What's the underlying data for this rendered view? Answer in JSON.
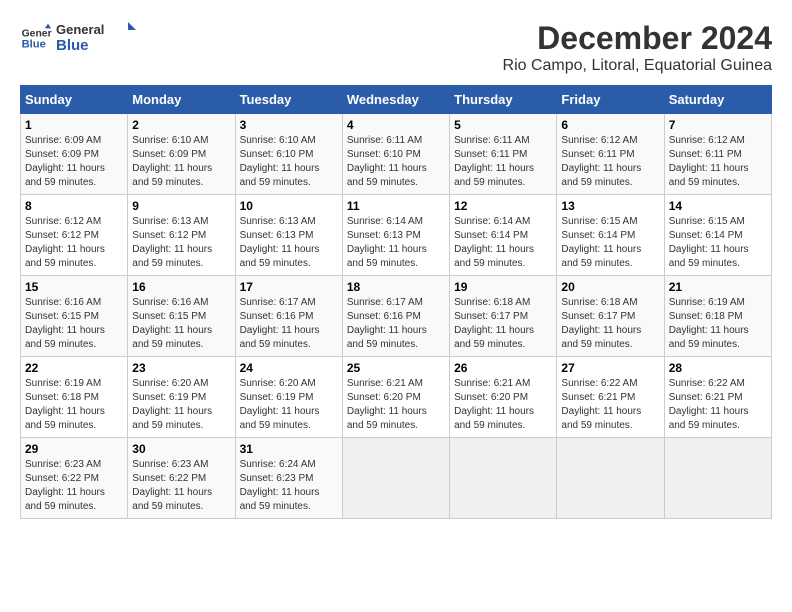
{
  "header": {
    "logo_general": "General",
    "logo_blue": "Blue",
    "title": "December 2024",
    "subtitle": "Rio Campo, Litoral, Equatorial Guinea"
  },
  "calendar": {
    "weekdays": [
      "Sunday",
      "Monday",
      "Tuesday",
      "Wednesday",
      "Thursday",
      "Friday",
      "Saturday"
    ],
    "weeks": [
      [
        {
          "day": "1",
          "sunrise": "6:09 AM",
          "sunset": "6:09 PM",
          "daylight": "11 hours and 59 minutes."
        },
        {
          "day": "2",
          "sunrise": "6:10 AM",
          "sunset": "6:09 PM",
          "daylight": "11 hours and 59 minutes."
        },
        {
          "day": "3",
          "sunrise": "6:10 AM",
          "sunset": "6:10 PM",
          "daylight": "11 hours and 59 minutes."
        },
        {
          "day": "4",
          "sunrise": "6:11 AM",
          "sunset": "6:10 PM",
          "daylight": "11 hours and 59 minutes."
        },
        {
          "day": "5",
          "sunrise": "6:11 AM",
          "sunset": "6:11 PM",
          "daylight": "11 hours and 59 minutes."
        },
        {
          "day": "6",
          "sunrise": "6:12 AM",
          "sunset": "6:11 PM",
          "daylight": "11 hours and 59 minutes."
        },
        {
          "day": "7",
          "sunrise": "6:12 AM",
          "sunset": "6:11 PM",
          "daylight": "11 hours and 59 minutes."
        }
      ],
      [
        {
          "day": "8",
          "sunrise": "6:12 AM",
          "sunset": "6:12 PM",
          "daylight": "11 hours and 59 minutes."
        },
        {
          "day": "9",
          "sunrise": "6:13 AM",
          "sunset": "6:12 PM",
          "daylight": "11 hours and 59 minutes."
        },
        {
          "day": "10",
          "sunrise": "6:13 AM",
          "sunset": "6:13 PM",
          "daylight": "11 hours and 59 minutes."
        },
        {
          "day": "11",
          "sunrise": "6:14 AM",
          "sunset": "6:13 PM",
          "daylight": "11 hours and 59 minutes."
        },
        {
          "day": "12",
          "sunrise": "6:14 AM",
          "sunset": "6:14 PM",
          "daylight": "11 hours and 59 minutes."
        },
        {
          "day": "13",
          "sunrise": "6:15 AM",
          "sunset": "6:14 PM",
          "daylight": "11 hours and 59 minutes."
        },
        {
          "day": "14",
          "sunrise": "6:15 AM",
          "sunset": "6:14 PM",
          "daylight": "11 hours and 59 minutes."
        }
      ],
      [
        {
          "day": "15",
          "sunrise": "6:16 AM",
          "sunset": "6:15 PM",
          "daylight": "11 hours and 59 minutes."
        },
        {
          "day": "16",
          "sunrise": "6:16 AM",
          "sunset": "6:15 PM",
          "daylight": "11 hours and 59 minutes."
        },
        {
          "day": "17",
          "sunrise": "6:17 AM",
          "sunset": "6:16 PM",
          "daylight": "11 hours and 59 minutes."
        },
        {
          "day": "18",
          "sunrise": "6:17 AM",
          "sunset": "6:16 PM",
          "daylight": "11 hours and 59 minutes."
        },
        {
          "day": "19",
          "sunrise": "6:18 AM",
          "sunset": "6:17 PM",
          "daylight": "11 hours and 59 minutes."
        },
        {
          "day": "20",
          "sunrise": "6:18 AM",
          "sunset": "6:17 PM",
          "daylight": "11 hours and 59 minutes."
        },
        {
          "day": "21",
          "sunrise": "6:19 AM",
          "sunset": "6:18 PM",
          "daylight": "11 hours and 59 minutes."
        }
      ],
      [
        {
          "day": "22",
          "sunrise": "6:19 AM",
          "sunset": "6:18 PM",
          "daylight": "11 hours and 59 minutes."
        },
        {
          "day": "23",
          "sunrise": "6:20 AM",
          "sunset": "6:19 PM",
          "daylight": "11 hours and 59 minutes."
        },
        {
          "day": "24",
          "sunrise": "6:20 AM",
          "sunset": "6:19 PM",
          "daylight": "11 hours and 59 minutes."
        },
        {
          "day": "25",
          "sunrise": "6:21 AM",
          "sunset": "6:20 PM",
          "daylight": "11 hours and 59 minutes."
        },
        {
          "day": "26",
          "sunrise": "6:21 AM",
          "sunset": "6:20 PM",
          "daylight": "11 hours and 59 minutes."
        },
        {
          "day": "27",
          "sunrise": "6:22 AM",
          "sunset": "6:21 PM",
          "daylight": "11 hours and 59 minutes."
        },
        {
          "day": "28",
          "sunrise": "6:22 AM",
          "sunset": "6:21 PM",
          "daylight": "11 hours and 59 minutes."
        }
      ],
      [
        {
          "day": "29",
          "sunrise": "6:23 AM",
          "sunset": "6:22 PM",
          "daylight": "11 hours and 59 minutes."
        },
        {
          "day": "30",
          "sunrise": "6:23 AM",
          "sunset": "6:22 PM",
          "daylight": "11 hours and 59 minutes."
        },
        {
          "day": "31",
          "sunrise": "6:24 AM",
          "sunset": "6:23 PM",
          "daylight": "11 hours and 59 minutes."
        },
        null,
        null,
        null,
        null
      ]
    ]
  }
}
